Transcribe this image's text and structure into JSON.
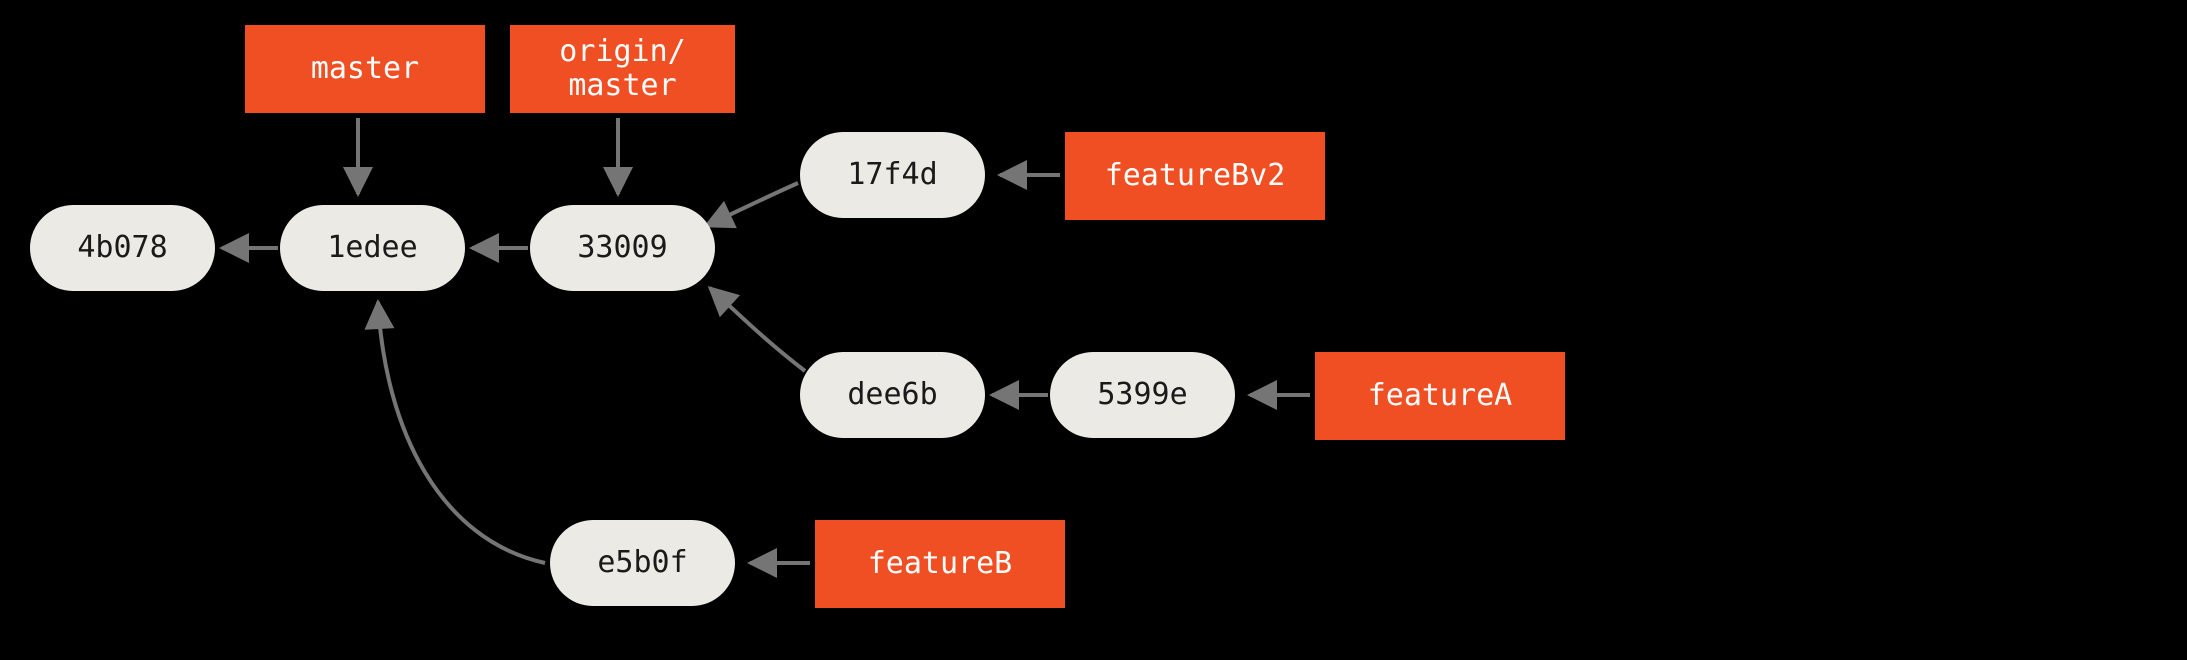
{
  "commits": {
    "c1": "4b078",
    "c2": "1edee",
    "c3": "33009",
    "c4": "17f4d",
    "c5": "dee6b",
    "c6": "5399e",
    "c7": "e5b0f"
  },
  "branches": {
    "master": "master",
    "origin_master": "origin/\nmaster",
    "featureBv2": "featureBv2",
    "featureA": "featureA",
    "featureB": "featureB"
  },
  "colors": {
    "commit_bg": "#ECEAE4",
    "commit_fg": "#1a1a1a",
    "branch_bg": "#F04E23",
    "branch_fg": "#ffffff",
    "edge": "#757575",
    "background": "#000000"
  },
  "edges": [
    {
      "from": "1edee",
      "to": "4b078"
    },
    {
      "from": "33009",
      "to": "1edee"
    },
    {
      "from": "17f4d",
      "to": "33009"
    },
    {
      "from": "dee6b",
      "to": "33009"
    },
    {
      "from": "5399e",
      "to": "dee6b"
    },
    {
      "from": "e5b0f",
      "to": "1edee"
    },
    {
      "from": "master",
      "to": "1edee"
    },
    {
      "from": "origin/master",
      "to": "33009"
    },
    {
      "from": "featureBv2",
      "to": "17f4d"
    },
    {
      "from": "featureA",
      "to": "5399e"
    },
    {
      "from": "featureB",
      "to": "e5b0f"
    }
  ]
}
